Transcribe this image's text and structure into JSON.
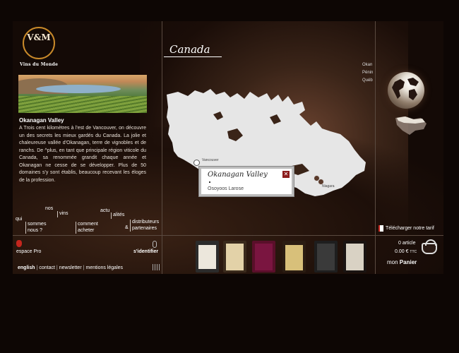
{
  "brand": {
    "logo_text": "V&M",
    "name": "Vins du Monde"
  },
  "region": {
    "title": "Okanagan Valley",
    "description": "A Trois cent kilomètres à l'est de Vancouver, on découvre un des secrets les mieux gardés du Canada. La jolie et chaleureuse vallée d'Okanagan, terre de vignobles et de ranchs. De ^plus, en tant que principale région viticole du Canada, sa renommée grandit chaque année et Okanagan ne cesse de se développer. Plus de 50 domaines s'y sont établis, beaucoup recevant les éloges de la profession."
  },
  "nav": {
    "qui": "qui",
    "sommes_nous": "sommes nous ?",
    "nos": "nos",
    "vins": "vins",
    "comment_acheter": "comment acheter",
    "actu": "actu",
    "alites": "alités",
    "amp": "&",
    "distributeurs_partenaires": "distributeurs partenaires"
  },
  "account": {
    "espace_pro": "espace Pro",
    "identifier": "s'identifier"
  },
  "footer": {
    "english": "english",
    "contact": "contact",
    "newsletter": "newsletter",
    "mentions": "mentions légales",
    "sep": "|"
  },
  "map": {
    "country": "Canada",
    "city_label_1": "Vancouver",
    "city_label_2": "Niagara",
    "popup_title": "Okanagan Valley",
    "popup_item": "Osoyoos Larose",
    "close_symbol": "✕"
  },
  "provinces": [
    "Okan",
    "Pénin",
    "Québ"
  ],
  "tarif": "Télécharger notre tarif",
  "cart": {
    "articles": "0 article",
    "price_value": "0.00 €",
    "price_unit": "TTC",
    "mon": "mon",
    "panier": "Panier"
  },
  "colors": {
    "accent": "#c98a2a",
    "background": "#140a06",
    "map_land": "#e6e6e6",
    "close": "#8b1c1c"
  }
}
